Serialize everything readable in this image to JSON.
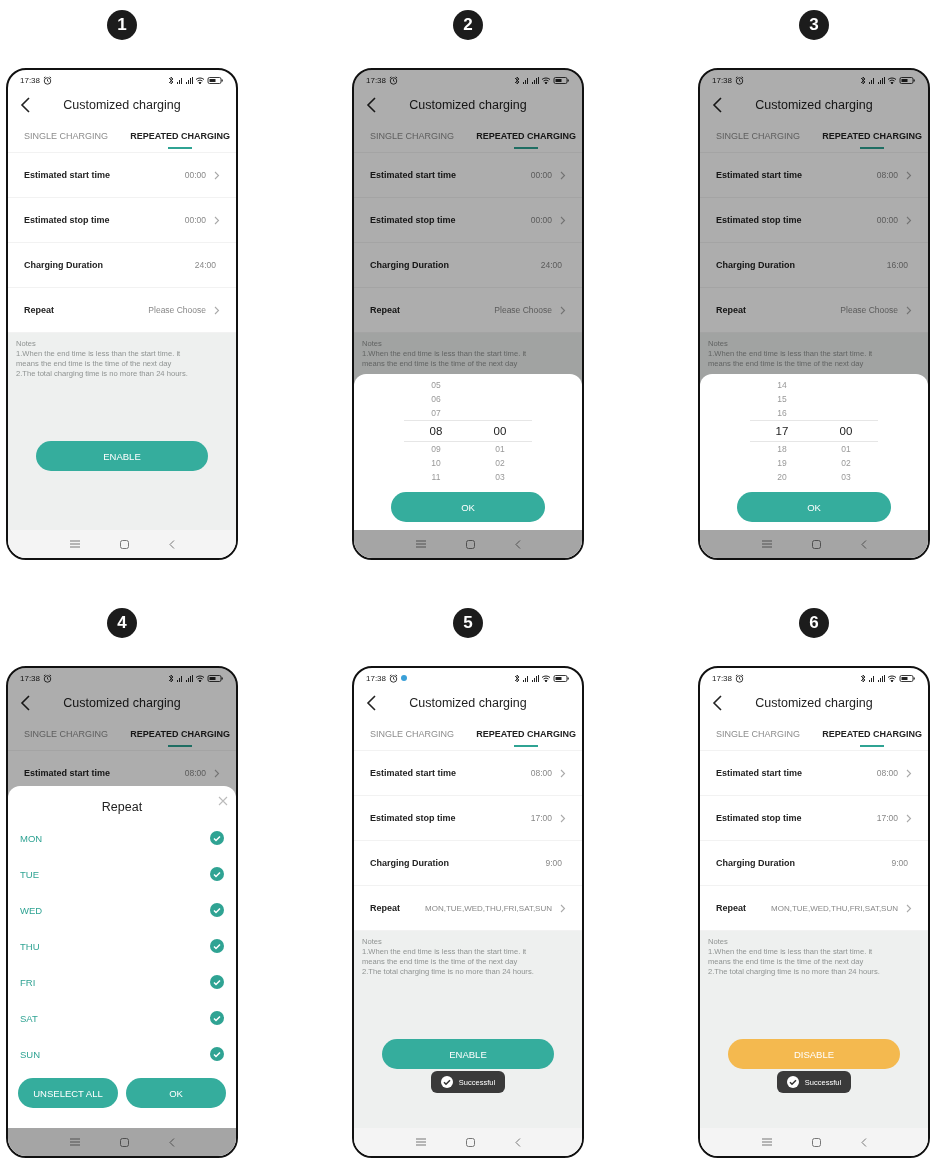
{
  "panels": [
    {
      "number": "1",
      "phone": {
        "status": {
          "time": "17:38",
          "alarm": true,
          "notification_dot": false
        },
        "title": "Customized charging",
        "tabs": [
          {
            "label": "SINGLE CHARGING",
            "selected": false
          },
          {
            "label": "REPEATED CHARGING",
            "selected": true
          }
        ],
        "rows": [
          {
            "label": "Estimated start time",
            "value": "00:00",
            "chevron": true
          },
          {
            "label": "Estimated stop time",
            "value": "00:00",
            "chevron": true
          },
          {
            "label": "Charging Duration",
            "value": "24:00",
            "chevron": false
          },
          {
            "label": "Repeat",
            "value": "Please Choose",
            "chevron": true
          }
        ],
        "notes": [
          "Notes",
          "1.When the end time is less than the start time. it",
          "means the end time is the time of the next day",
          "2.The total charging time is no more than 24 hours."
        ],
        "button": {
          "label": "ENABLE",
          "kind": "enable"
        }
      }
    },
    {
      "number": "2",
      "phone": {
        "status": {
          "time": "17:38",
          "alarm": true,
          "notification_dot": false
        },
        "title": "Customized charging",
        "tabs": [
          {
            "label": "SINGLE CHARGING",
            "selected": false
          },
          {
            "label": "REPEATED CHARGING",
            "selected": true
          }
        ],
        "rows": [
          {
            "label": "Estimated start time",
            "value": "00:00",
            "chevron": true
          },
          {
            "label": "Estimated stop time",
            "value": "00:00",
            "chevron": true
          },
          {
            "label": "Charging Duration",
            "value": "24:00",
            "chevron": false
          },
          {
            "label": "Repeat",
            "value": "Please Choose",
            "chevron": true
          }
        ],
        "notes": [
          "Notes",
          "1.When the end time is less than the start time. it",
          "means the end time is the time of the next day"
        ],
        "overlay": {
          "kind": "time_picker",
          "columns": [
            {
              "items": [
                {
                  "text": "05",
                  "selected": false
                },
                {
                  "text": "06",
                  "selected": false
                },
                {
                  "text": "07",
                  "selected": false
                },
                {
                  "text": "08",
                  "selected": true
                },
                {
                  "text": "09",
                  "selected": false
                },
                {
                  "text": "10",
                  "selected": false
                },
                {
                  "text": "11",
                  "selected": false
                }
              ]
            },
            {
              "items": [
                {
                  "text": "00",
                  "selected": true
                },
                {
                  "text": "01",
                  "selected": false
                },
                {
                  "text": "02",
                  "selected": false
                },
                {
                  "text": "03",
                  "selected": false
                }
              ]
            }
          ],
          "buttons": [
            "OK"
          ]
        }
      }
    },
    {
      "number": "3",
      "phone": {
        "status": {
          "time": "17:38",
          "alarm": true,
          "notification_dot": false
        },
        "title": "Customized charging",
        "tabs": [
          {
            "label": "SINGLE CHARGING",
            "selected": false
          },
          {
            "label": "REPEATED CHARGING",
            "selected": true
          }
        ],
        "rows": [
          {
            "label": "Estimated start time",
            "value": "08:00",
            "chevron": true
          },
          {
            "label": "Estimated stop time",
            "value": "00:00",
            "chevron": true
          },
          {
            "label": "Charging Duration",
            "value": "16:00",
            "chevron": false
          },
          {
            "label": "Repeat",
            "value": "Please Choose",
            "chevron": true
          }
        ],
        "notes": [
          "Notes",
          "1.When the end time is less than the start time. it",
          "means the end time is the time of the next day"
        ],
        "overlay": {
          "kind": "time_picker",
          "columns": [
            {
              "items": [
                {
                  "text": "14",
                  "selected": false
                },
                {
                  "text": "15",
                  "selected": false
                },
                {
                  "text": "16",
                  "selected": false
                },
                {
                  "text": "17",
                  "selected": true
                },
                {
                  "text": "18",
                  "selected": false
                },
                {
                  "text": "19",
                  "selected": false
                },
                {
                  "text": "20",
                  "selected": false
                }
              ]
            },
            {
              "items": [
                {
                  "text": "00",
                  "selected": true
                },
                {
                  "text": "01",
                  "selected": false
                },
                {
                  "text": "02",
                  "selected": false
                },
                {
                  "text": "03",
                  "selected": false
                }
              ]
            }
          ],
          "buttons": [
            "OK"
          ]
        }
      }
    },
    {
      "number": "4",
      "phone": {
        "status": {
          "time": "17:38",
          "alarm": true,
          "notification_dot": false
        },
        "title": "Customized charging",
        "tabs": [
          {
            "label": "SINGLE CHARGING",
            "selected": false
          },
          {
            "label": "REPEATED CHARGING",
            "selected": true
          }
        ],
        "rows": [
          {
            "label": "Estimated start time",
            "value": "08:00",
            "chevron": true
          }
        ],
        "overlay": {
          "kind": "repeat_sheet",
          "title": "Repeat",
          "days": [
            {
              "label": "MON",
              "checked": true
            },
            {
              "label": "TUE",
              "checked": true
            },
            {
              "label": "WED",
              "checked": true
            },
            {
              "label": "THU",
              "checked": true
            },
            {
              "label": "FRI",
              "checked": true
            },
            {
              "label": "SAT",
              "checked": true
            },
            {
              "label": "SUN",
              "checked": true
            }
          ],
          "buttons": [
            "UNSELECT ALL",
            "OK"
          ]
        }
      }
    },
    {
      "number": "5",
      "phone": {
        "status": {
          "time": "17:38",
          "alarm": true,
          "notification_dot": true
        },
        "title": "Customized charging",
        "tabs": [
          {
            "label": "SINGLE CHARGING",
            "selected": false
          },
          {
            "label": "REPEATED CHARGING",
            "selected": true
          }
        ],
        "rows": [
          {
            "label": "Estimated start time",
            "value": "08:00",
            "chevron": true
          },
          {
            "label": "Estimated stop time",
            "value": "17:00",
            "chevron": true
          },
          {
            "label": "Charging Duration",
            "value": "9:00",
            "chevron": false
          },
          {
            "label": "Repeat",
            "value": "MON,TUE,WED,THU,FRI,SAT,SUN",
            "chevron": true
          }
        ],
        "notes": [
          "Notes",
          "1.When the end time is less than the start time. it",
          "means the end time is the time of the next day",
          "2.The total charging time is no more than 24 hours."
        ],
        "button": {
          "label": "ENABLE",
          "kind": "enable"
        },
        "toast": "Successful"
      }
    },
    {
      "number": "6",
      "phone": {
        "status": {
          "time": "17:38",
          "alarm": true,
          "notification_dot": false
        },
        "title": "Customized charging",
        "tabs": [
          {
            "label": "SINGLE CHARGING",
            "selected": false
          },
          {
            "label": "REPEATED CHARGING",
            "selected": true
          }
        ],
        "rows": [
          {
            "label": "Estimated start time",
            "value": "08:00",
            "chevron": true
          },
          {
            "label": "Estimated stop time",
            "value": "17:00",
            "chevron": true
          },
          {
            "label": "Charging Duration",
            "value": "9:00",
            "chevron": false
          },
          {
            "label": "Repeat",
            "value": "MON,TUE,WED,THU,FRI,SAT,SUN",
            "chevron": true
          }
        ],
        "notes": [
          "Notes",
          "1.When the end time is less than the start time. it",
          "means the end time is the time of the next day",
          "2.The total charging time is no more than 24 hours."
        ],
        "button": {
          "label": "DISABLE",
          "kind": "disable"
        },
        "toast": "Successful"
      }
    }
  ]
}
